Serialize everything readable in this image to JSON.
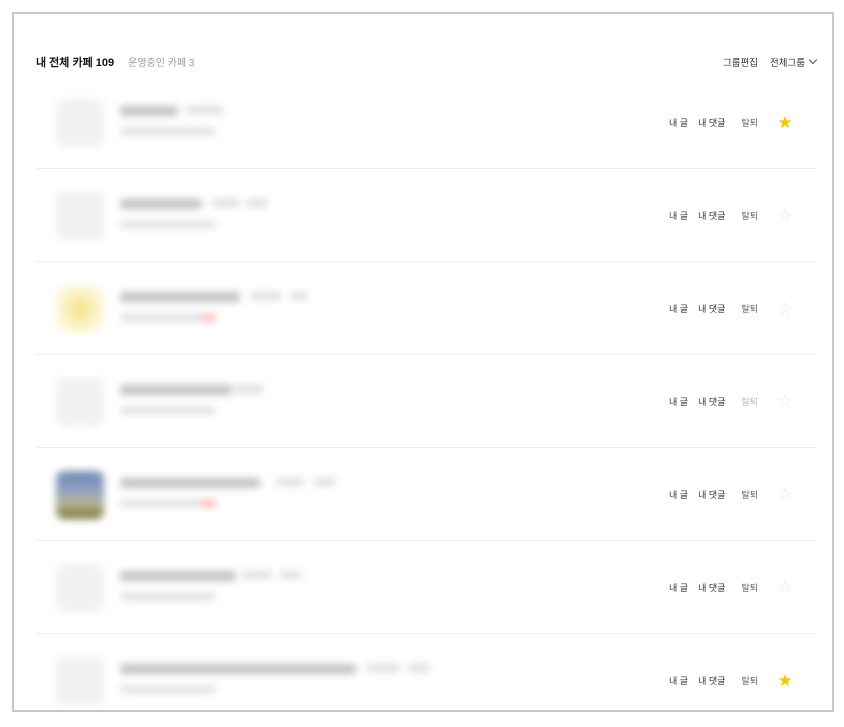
{
  "header": {
    "tab_all": "내 전체 카페 109",
    "tab_managed": "운영중인 카페 3",
    "edit_group": "그룹편집",
    "group_select": "전체그룹"
  },
  "cafes": [
    {
      "my_posts": "내 글",
      "my_comments": "내 댓글",
      "leave": "탈퇴",
      "favorite": true,
      "thumb": "blank"
    },
    {
      "my_posts": "내 글",
      "my_comments": "내 댓글",
      "leave": "탈퇴",
      "favorite": false,
      "thumb": "blank"
    },
    {
      "my_posts": "내 글",
      "my_comments": "내 댓글",
      "leave": "탈퇴",
      "favorite": false,
      "thumb": "yellow"
    },
    {
      "my_posts": "내 글",
      "my_comments": "내 댓글",
      "leave": "탈퇴",
      "favorite": false,
      "thumb": "blank"
    },
    {
      "my_posts": "내 글",
      "my_comments": "내 댓글",
      "leave": "탈퇴",
      "favorite": false,
      "thumb": "photo"
    },
    {
      "my_posts": "내 글",
      "my_comments": "내 댓글",
      "leave": "탈퇴",
      "favorite": false,
      "thumb": "blank"
    },
    {
      "my_posts": "내 글",
      "my_comments": "내 댓글",
      "leave": "탈퇴",
      "favorite": true,
      "thumb": "blank"
    }
  ],
  "icons": {
    "star": "star-icon",
    "chevron": "chevron-down-icon"
  },
  "colors": {
    "star_on": "#f6c600",
    "star_off": "#e6e6e6"
  }
}
